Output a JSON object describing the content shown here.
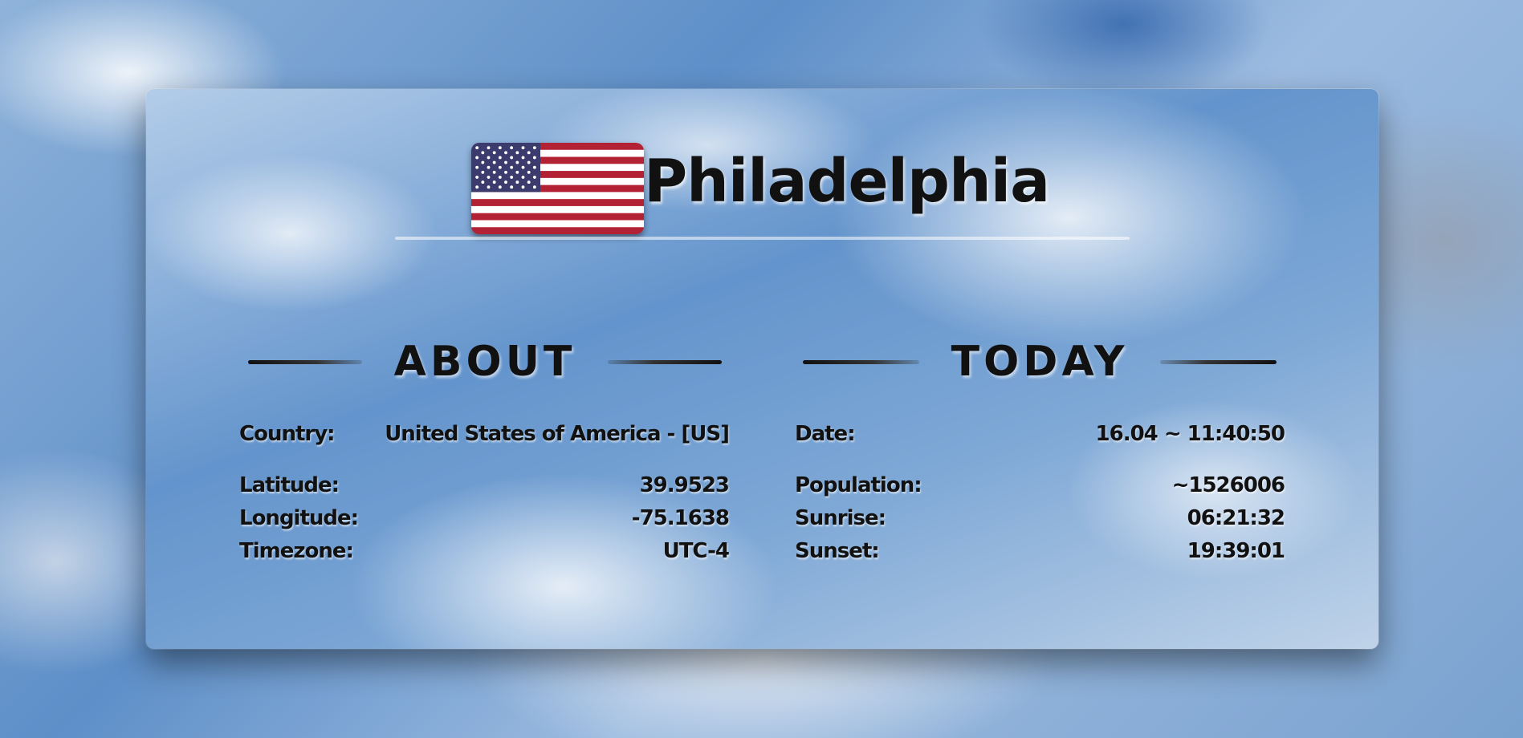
{
  "city": "Philadelphia",
  "flag": {
    "icon": "us-flag-icon",
    "stripe_red": "#b22234",
    "canton_blue": "#3c3b6e"
  },
  "about": {
    "heading": "ABOUT",
    "rows": [
      {
        "label": "Country:",
        "value": "United States of America - [US]"
      },
      {
        "label": "Latitude:",
        "value": "39.9523"
      },
      {
        "label": "Longitude:",
        "value": "-75.1638"
      },
      {
        "label": "Timezone:",
        "value": "UTC-4"
      }
    ]
  },
  "today": {
    "heading": "TODAY",
    "rows": [
      {
        "label": "Date:",
        "value": "16.04 ~ 11:40:50"
      },
      {
        "label": "Population:",
        "value": "~1526006"
      },
      {
        "label": "Sunrise:",
        "value": "06:21:32"
      },
      {
        "label": "Sunset:",
        "value": "19:39:01"
      }
    ]
  }
}
